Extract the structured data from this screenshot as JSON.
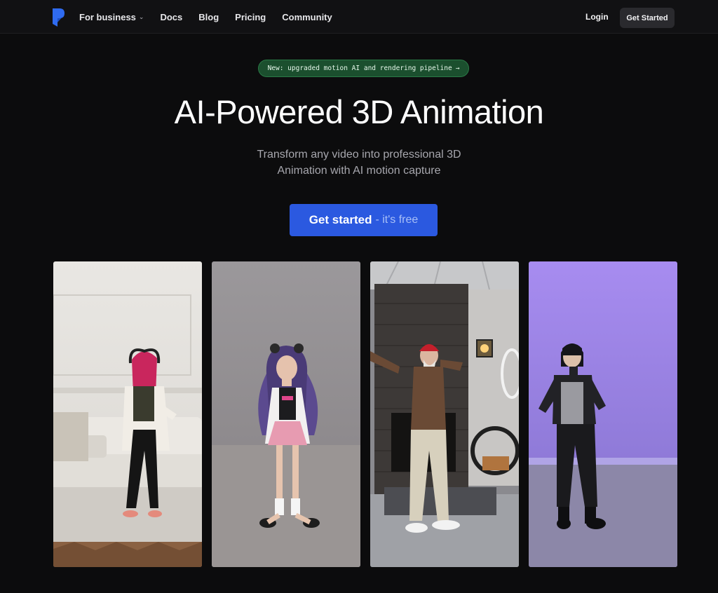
{
  "nav": {
    "logo_icon": "brand-p-logo",
    "links": [
      {
        "label": "For business",
        "has_dropdown": true
      },
      {
        "label": "Docs"
      },
      {
        "label": "Blog"
      },
      {
        "label": "Pricing"
      },
      {
        "label": "Community"
      }
    ],
    "login_label": "Login",
    "cta_label": "Get Started"
  },
  "hero": {
    "announcement": "New: upgraded motion AI and rendering pipeline",
    "announcement_arrow": "→",
    "title": "AI-Powered 3D Animation",
    "subtitle_line1": "Transform any video into professional 3D",
    "subtitle_line2": "Animation with AI motion capture",
    "cta_main": "Get started",
    "cta_suffix": "- it's free"
  },
  "gallery": {
    "cards": [
      {
        "subject": "real-dancer-woman-with-headphones",
        "background": "white-living-room"
      },
      {
        "subject": "3d-anime-girl-avatar",
        "background": "gray-studio"
      },
      {
        "subject": "real-man-red-beanie-dancing",
        "background": "brick-fireplace-room"
      },
      {
        "subject": "3d-anime-boy-avatar",
        "background": "purple-studio"
      }
    ]
  },
  "colors": {
    "page_bg": "#0c0c0d",
    "nav_bg": "#111113",
    "accent_blue": "#2b59e0",
    "announce_green": "#1b4f2e"
  }
}
